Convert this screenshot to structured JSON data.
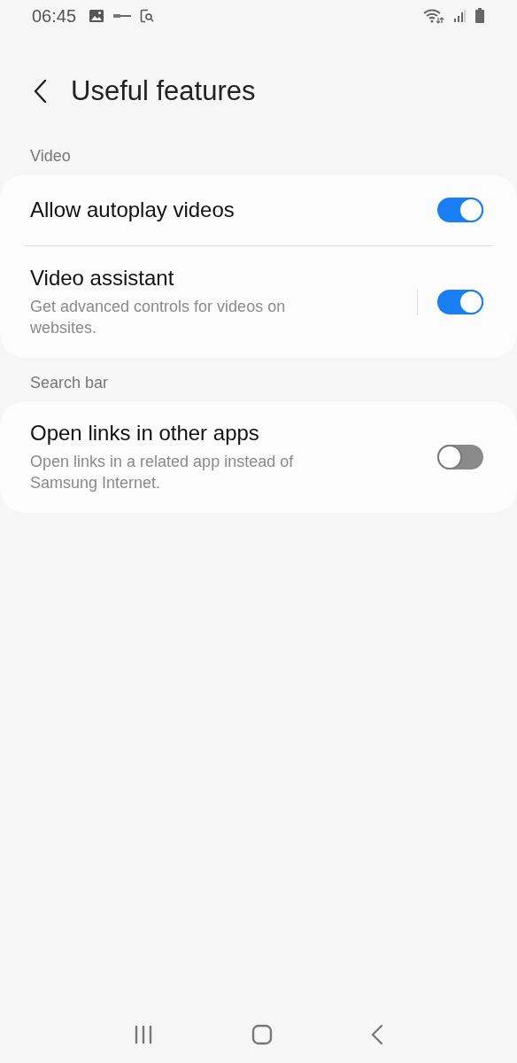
{
  "status_bar": {
    "time": "06:45"
  },
  "header": {
    "title": "Useful features"
  },
  "sections": [
    {
      "label": "Video",
      "items": [
        {
          "kind": "switch",
          "title": "Allow autoplay videos",
          "on": true
        },
        {
          "kind": "split-switch",
          "title": "Video assistant",
          "subtitle": "Get advanced controls for videos on websites.",
          "on": true
        }
      ]
    },
    {
      "label": "Search bar",
      "items": [
        {
          "kind": "switch",
          "title": "Open links in other apps",
          "subtitle": "Open links in a related app instead of Samsung Internet.",
          "on": false
        }
      ]
    }
  ]
}
